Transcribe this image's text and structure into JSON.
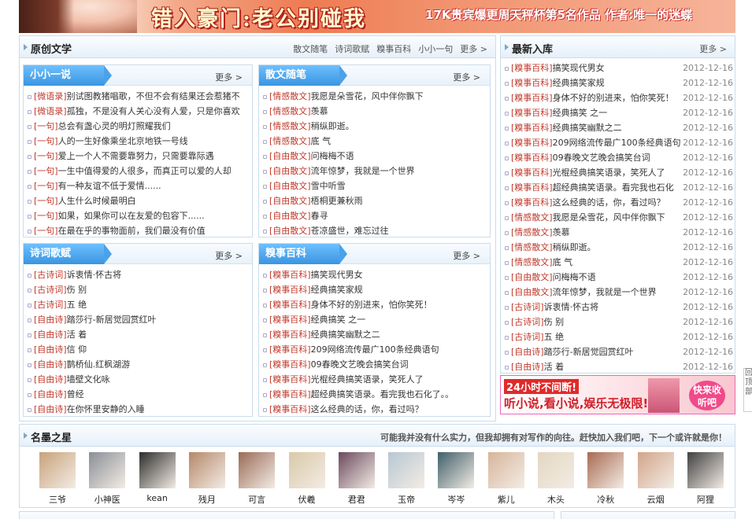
{
  "banner": {
    "title": "错入豪门:老公别碰我",
    "subtitle": "17K贵宾爆更周天秤杯第5名作品 作者:唯一的迷蝶"
  },
  "original": {
    "title": "原创文学",
    "links": [
      "散文随笔",
      "诗词歌赋",
      "糗事百科",
      "小小一句",
      "更多 >"
    ]
  },
  "xiaoxiao": {
    "title": "小小一说",
    "more": "更多 >",
    "items": [
      {
        "cat": "[微语录]",
        "text": "别试图教猪唱歌，不但不会有结果还会惹猪不"
      },
      {
        "cat": "[微语录]",
        "text": "孤独，不是没有人关心没有人爱，只是你喜欢"
      },
      {
        "cat": "[一句]",
        "text": "总会有盏心灵的明灯照耀我们"
      },
      {
        "cat": "[一句]",
        "text": "人的一生好像乘坐北京地铁一号线"
      },
      {
        "cat": "[一句]",
        "text": "爱上一个人不需要靠努力，只需要靠际遇"
      },
      {
        "cat": "[一句]",
        "text": "一生中值得爱的人很多，而真正可以爱的人却"
      },
      {
        "cat": "[一句]",
        "text": "有一种友谊不低于爱情......"
      },
      {
        "cat": "[一句]",
        "text": "人生什么时候最明白"
      },
      {
        "cat": "[一句]",
        "text": "如果，如果你可以在友爱的包容下......"
      },
      {
        "cat": "[一句]",
        "text": "在最在乎的事物面前，我们最没有价值"
      }
    ]
  },
  "sanwen": {
    "title": "散文随笔",
    "more": "更多 >",
    "items": [
      {
        "cat": "[情感散文]",
        "text": "我愿是朵雪花，风中伴你飘下"
      },
      {
        "cat": "[情感散文]",
        "text": "羡慕"
      },
      {
        "cat": "[情感散文]",
        "text": "稍纵即逝。"
      },
      {
        "cat": "[情感散文]",
        "text": "底 气"
      },
      {
        "cat": "[自由散文]",
        "text": "问梅梅不语"
      },
      {
        "cat": "[自由散文]",
        "text": "流年惊梦，我就是一个世界"
      },
      {
        "cat": "[自由散文]",
        "text": "雪中听雪"
      },
      {
        "cat": "[自由散文]",
        "text": "梧桐更兼秋雨"
      },
      {
        "cat": "[自由散文]",
        "text": "春寻"
      },
      {
        "cat": "[自由散文]",
        "text": "苍凉盛世，难忘过往"
      }
    ]
  },
  "shici": {
    "title": "诗词歌赋",
    "more": "更多 >",
    "items": [
      {
        "cat": "[古诗词]",
        "text": "诉衷情·怀古将"
      },
      {
        "cat": "[古诗词]",
        "text": "伤 别"
      },
      {
        "cat": "[古诗词]",
        "text": "五 绝"
      },
      {
        "cat": "[自由诗]",
        "text": "踏莎行-新居觉园赏红叶"
      },
      {
        "cat": "[自由诗]",
        "text": "活 着"
      },
      {
        "cat": "[自由诗]",
        "text": "信 仰"
      },
      {
        "cat": "[自由诗]",
        "text": "鹊桥仙.红枫湖游"
      },
      {
        "cat": "[自由诗]",
        "text": "墙壁文化咏"
      },
      {
        "cat": "[自由诗]",
        "text": "曾经"
      },
      {
        "cat": "[自由诗]",
        "text": "在你怀里安静的入睡"
      }
    ]
  },
  "qiushi": {
    "title": "糗事百科",
    "more": "更多 >",
    "items": [
      {
        "cat": "[糗事百科]",
        "text": "搞笑现代男女"
      },
      {
        "cat": "[糗事百科]",
        "text": "经典搞笑家规"
      },
      {
        "cat": "[糗事百科]",
        "text": "身体不好的别进来，怕你笑死！"
      },
      {
        "cat": "[糗事百科]",
        "text": "经典搞笑 之一"
      },
      {
        "cat": "[糗事百科]",
        "text": "经典搞笑幽默之二"
      },
      {
        "cat": "[糗事百科]",
        "text": "209网络流传最广100条经典语句"
      },
      {
        "cat": "[糗事百科]",
        "text": "09春晚文艺晚会搞笑台词"
      },
      {
        "cat": "[糗事百科]",
        "text": "光棍经典搞笑语录，笑死人了"
      },
      {
        "cat": "[糗事百科]",
        "text": "超经典搞笑语录。看完我也石化了。。"
      },
      {
        "cat": "[糗事百科]",
        "text": "这么经典的话，你，看过吗？"
      }
    ]
  },
  "latest": {
    "title": "最新入库",
    "more": "更多 >",
    "items": [
      {
        "cat": "[糗事百科]",
        "text": "搞笑现代男女",
        "date": "2012-12-16"
      },
      {
        "cat": "[糗事百科]",
        "text": "经典搞笑家规",
        "date": "2012-12-16"
      },
      {
        "cat": "[糗事百科]",
        "text": "身体不好的别进来，怕你笑死！",
        "date": "2012-12-16"
      },
      {
        "cat": "[糗事百科]",
        "text": "经典搞笑 之一",
        "date": "2012-12-16"
      },
      {
        "cat": "[糗事百科]",
        "text": "经典搞笑幽默之二",
        "date": "2012-12-16"
      },
      {
        "cat": "[糗事百科]",
        "text": "209网络流传最广100条经典语句",
        "date": "2012-12-16"
      },
      {
        "cat": "[糗事百科]",
        "text": "09春晚文艺晚会搞笑台词",
        "date": "2012-12-16"
      },
      {
        "cat": "[糗事百科]",
        "text": "光棍经典搞笑语录，笑死人了",
        "date": "2012-12-16"
      },
      {
        "cat": "[糗事百科]",
        "text": "超经典搞笑语录。看完我也石化",
        "date": "2012-12-16"
      },
      {
        "cat": "[糗事百科]",
        "text": "这么经典的话，你，看过吗？",
        "date": "2012-12-16"
      },
      {
        "cat": "[情感散文]",
        "text": "我愿是朵雪花，风中伴你飘下",
        "date": "2012-12-16"
      },
      {
        "cat": "[情感散文]",
        "text": "羡慕",
        "date": "2012-12-16"
      },
      {
        "cat": "[情感散文]",
        "text": "稍纵即逝。",
        "date": "2012-12-16"
      },
      {
        "cat": "[情感散文]",
        "text": "底 气",
        "date": "2012-12-16"
      },
      {
        "cat": "[自由散文]",
        "text": "问梅梅不语",
        "date": "2012-12-16"
      },
      {
        "cat": "[自由散文]",
        "text": "流年惊梦，我就是一个世界",
        "date": "2012-12-16"
      },
      {
        "cat": "[古诗词]",
        "text": "诉衷情·怀古将",
        "date": "2012-12-16"
      },
      {
        "cat": "[古诗词]",
        "text": "伤 别",
        "date": "2012-12-16"
      },
      {
        "cat": "[古诗词]",
        "text": "五 绝",
        "date": "2012-12-16"
      },
      {
        "cat": "[自由诗]",
        "text": "踏莎行-新居觉园赏红叶",
        "date": "2012-12-16"
      },
      {
        "cat": "[自由诗]",
        "text": "活 着",
        "date": "2012-12-16"
      }
    ]
  },
  "promo": {
    "line1": "24小时不间断!",
    "line2": "听小说,看小说,娱乐无极限!",
    "badge": "快来收听吧"
  },
  "stars": {
    "title": "名墨之星",
    "slogan": "可能我并没有什么实力，但我却拥有对写作的向往。赶快加入我们吧，下一个或许就是你！",
    "people": [
      {
        "name": "三爷",
        "color": "#c8a27a"
      },
      {
        "name": "小神医",
        "color": "#8a8f96"
      },
      {
        "name": "kean",
        "color": "#2d2d2d"
      },
      {
        "name": "残月",
        "color": "#b5876a"
      },
      {
        "name": "可言",
        "color": "#9a6b58"
      },
      {
        "name": "伏羲",
        "color": "#d9c9a8"
      },
      {
        "name": "君君",
        "color": "#6b4a5e"
      },
      {
        "name": "玉帝",
        "color": "#b7c7d3"
      },
      {
        "name": "岑岑",
        "color": "#3f5f6a"
      },
      {
        "name": "紫儿",
        "color": "#d7b59a"
      },
      {
        "name": "木头",
        "color": "#e3d7c2"
      },
      {
        "name": "冷秋",
        "color": "#a86a52"
      },
      {
        "name": "云烟",
        "color": "#d2a58a"
      },
      {
        "name": "阿狸",
        "color": "#404040"
      }
    ]
  },
  "sidebar": {
    "label": "回顶部"
  }
}
